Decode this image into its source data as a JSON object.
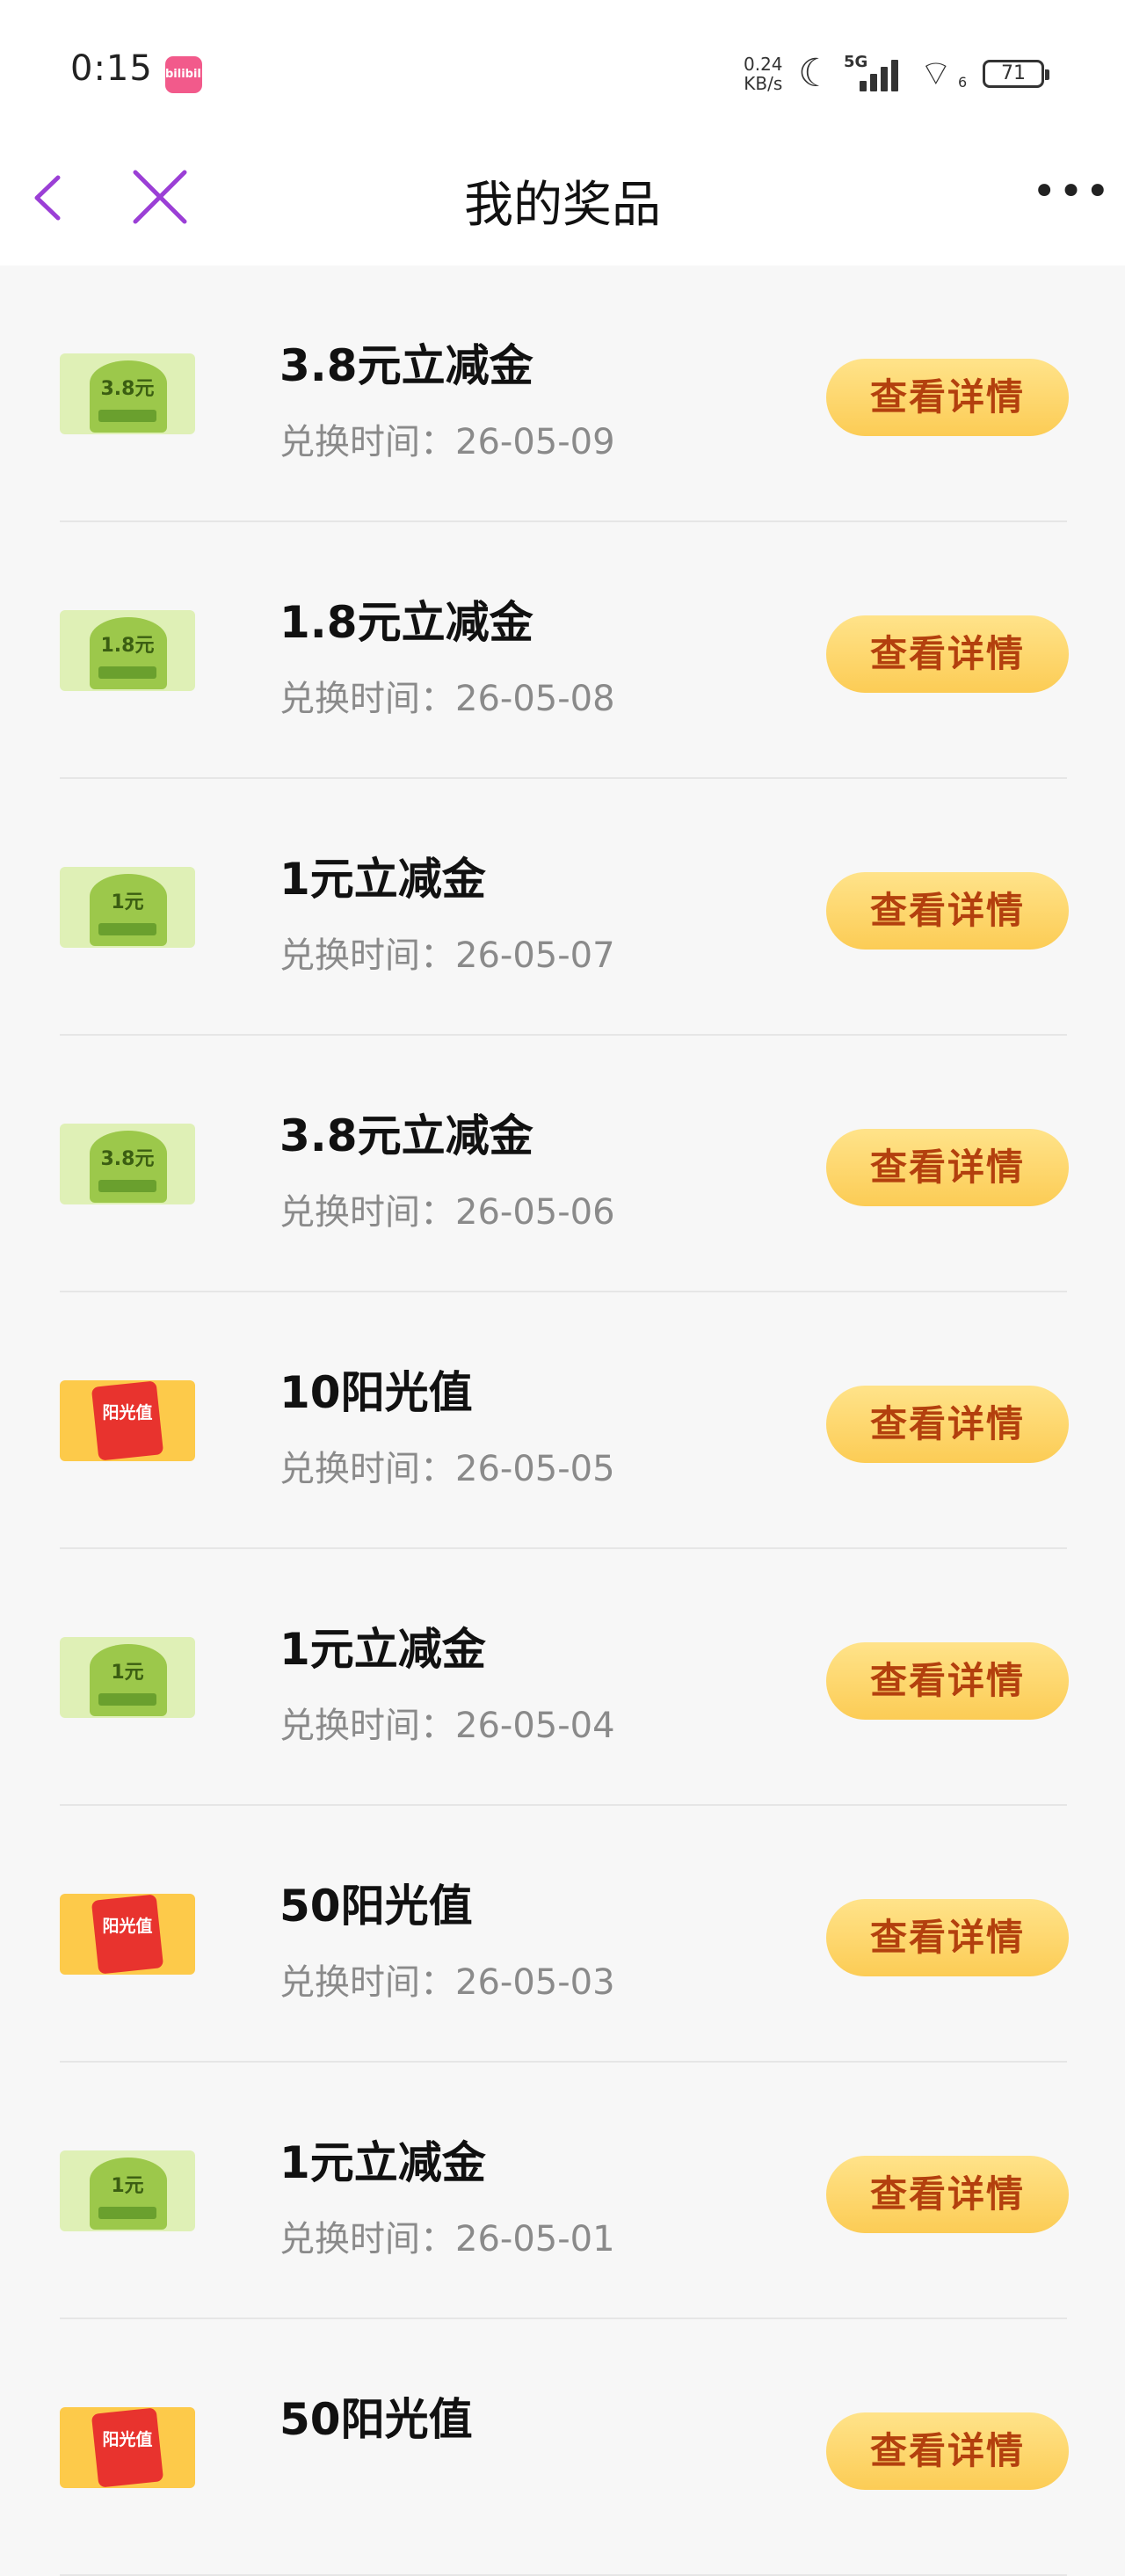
{
  "status_bar": {
    "time": "0:15",
    "app_icon_text": "bilibili",
    "net_speed_value": "0.24",
    "net_speed_unit": "KB/s",
    "network_type": "5G",
    "wifi_badge": "6",
    "battery_level": "71"
  },
  "header": {
    "title": "我的奖品",
    "accent_color": "#9b3fd6"
  },
  "prizes": [
    {
      "name": "3.8元立减金",
      "date": "兑换时间：26-05-09",
      "button": "查看详情",
      "thumb_type": "wechat-cash",
      "thumb_amount": "3.8元"
    },
    {
      "name": "1.8元立减金",
      "date": "兑换时间：26-05-08",
      "button": "查看详情",
      "thumb_type": "wechat-cash",
      "thumb_amount": "1.8元"
    },
    {
      "name": "1元立减金",
      "date": "兑换时间：26-05-07",
      "button": "查看详情",
      "thumb_type": "wechat-cash",
      "thumb_amount": "1元"
    },
    {
      "name": "3.8元立减金",
      "date": "兑换时间：26-05-06",
      "button": "查看详情",
      "thumb_type": "wechat-cash",
      "thumb_amount": "3.8元"
    },
    {
      "name": "10阳光值",
      "date": "兑换时间：26-05-05",
      "button": "查看详情",
      "thumb_type": "sunshine",
      "thumb_amount": "阳光值"
    },
    {
      "name": "1元立减金",
      "date": "兑换时间：26-05-04",
      "button": "查看详情",
      "thumb_type": "wechat-cash",
      "thumb_amount": "1元"
    },
    {
      "name": "50阳光值",
      "date": "兑换时间：26-05-03",
      "button": "查看详情",
      "thumb_type": "sunshine",
      "thumb_amount": "阳光值"
    },
    {
      "name": "1元立减金",
      "date": "兑换时间：26-05-01",
      "button": "查看详情",
      "thumb_type": "wechat-cash",
      "thumb_amount": "1元"
    },
    {
      "name": "50阳光值",
      "date": "",
      "button": "查看详情",
      "thumb_type": "sunshine",
      "thumb_amount": "阳光值"
    }
  ]
}
